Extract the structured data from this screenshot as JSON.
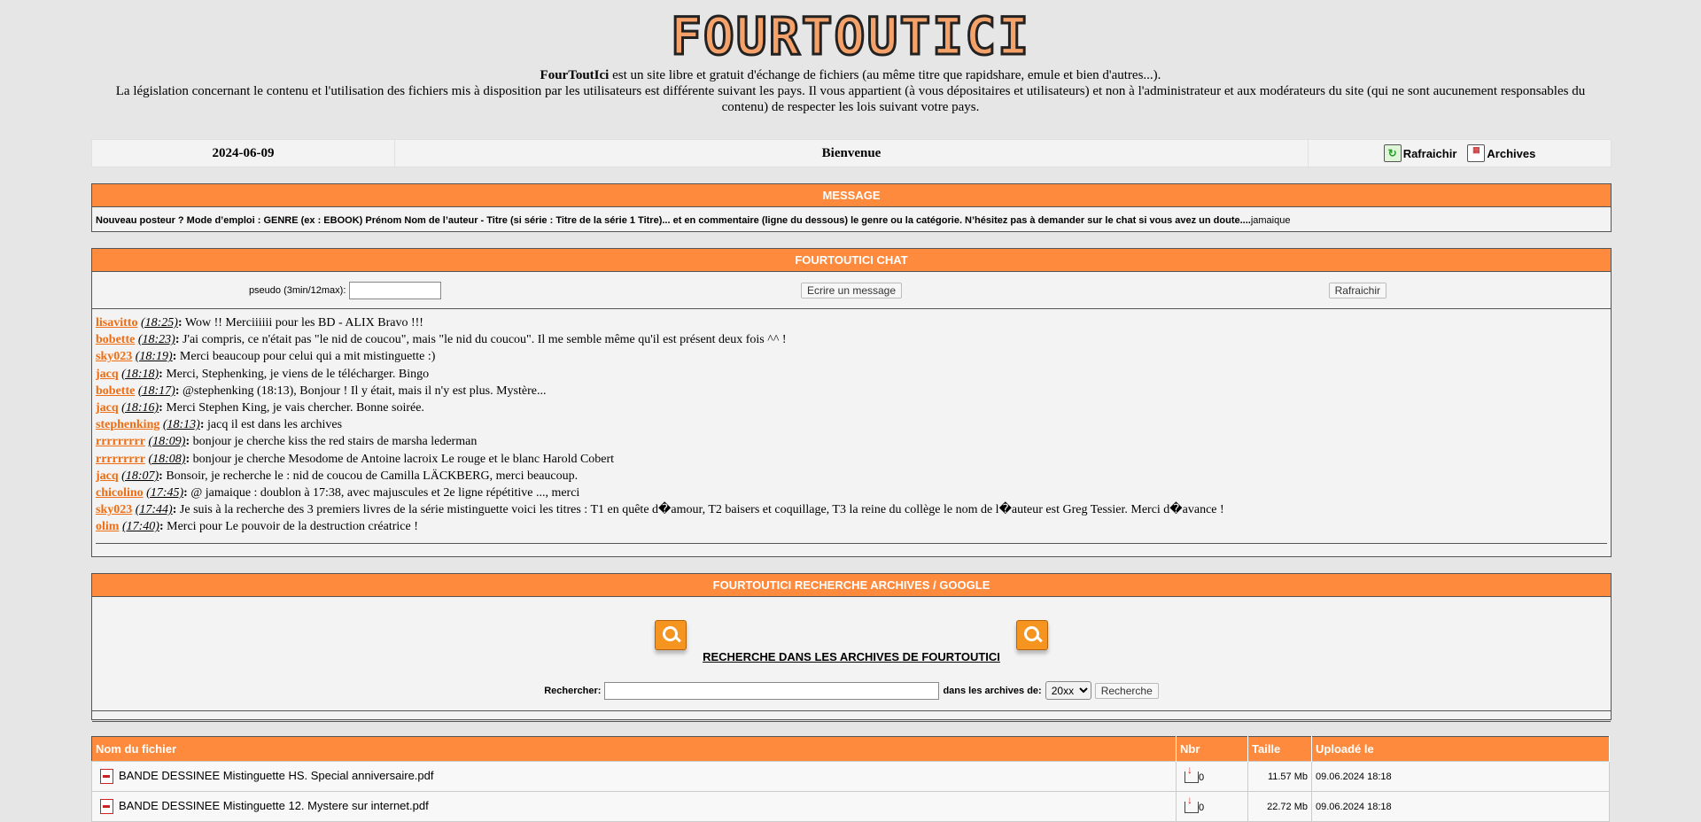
{
  "logo_text": "FOURTOUTICI",
  "intro": {
    "site_name": "FourToutIci",
    "line1_rest": " est un site libre et gratuit d'échange de fichiers (au même titre que rapidshare, emule et bien d'autres...).",
    "line2": "La législation concernant le contenu et l'utilisation des fichiers mis à disposition par les utilisateurs est différente suivant les pays. Il vous appartient (à vous dépositaires et utilisateurs) et non à l'administrateur et aux modérateurs du site (qui ne sont aucunement responsables du contenu) de respecter les lois suivant votre pays."
  },
  "topbar": {
    "date": "2024-06-09",
    "welcome": "Bienvenue",
    "refresh_label": "Rafraichir",
    "archives_label": "Archives"
  },
  "message": {
    "header": "MESSAGE",
    "text": "Nouveau posteur ? Mode d’emploi : GENRE (ex : EBOOK) Prénom Nom de l’auteur - Titre (si série : Titre de la série 1 Titre)... et en commentaire (ligne du dessous) le genre ou la catégorie. N’hésitez pas à demander sur le chat si vous avez un doute....",
    "author": "jamaique"
  },
  "chat": {
    "header": "FOURTOUTICI CHAT",
    "pseudo_label": "pseudo (3min/12max):",
    "pseudo_value": "",
    "write_button": "Ecrire un message",
    "refresh_button": "Rafraichir",
    "messages": [
      {
        "nick": "lisavitto",
        "time": "(18:25)",
        "text": " Wow !! Merciiiiii pour les BD - ALIX Bravo !!!"
      },
      {
        "nick": "bobette",
        "time": "(18:23)",
        "text": " J'ai compris, ce n'était pas \"le nid de coucou\", mais \"le nid du coucou\". Il me semble même qu'il est présent deux fois ^^ !"
      },
      {
        "nick": "sky023",
        "time": "(18:19)",
        "text": " Merci beaucoup pour celui qui a mit mistinguette :)"
      },
      {
        "nick": "jacq",
        "time": "(18:18)",
        "text": " Merci, Stephenking, je viens de le télécharger. Bingo"
      },
      {
        "nick": "bobette",
        "time": "(18:17)",
        "text": " @stephenking (18:13), Bonjour ! Il y était, mais il n'y est plus. Mystère..."
      },
      {
        "nick": "jacq",
        "time": "(18:16)",
        "text": " Merci Stephen King, je vais chercher. Bonne soirée."
      },
      {
        "nick": "stephenking",
        "time": "(18:13)",
        "text": " jacq il est dans les archives"
      },
      {
        "nick": "rrrrrrrrr",
        "time": "(18:09)",
        "text": " bonjour je cherche kiss the red stairs de marsha lederman"
      },
      {
        "nick": "rrrrrrrrr",
        "time": "(18:08)",
        "text": " bonjour je cherche Mesodome de Antoine lacroix Le rouge et le blanc Harold Cobert"
      },
      {
        "nick": "jacq",
        "time": "(18:07)",
        "text": " Bonsoir, je recherche le : nid de coucou de Camilla LÄCKBERG, merci beaucoup."
      },
      {
        "nick": "chicolino",
        "time": "(17:45)",
        "text": " @ jamaique : doublon à 17:38, avec majuscules et 2e ligne répétitive ..., merci"
      },
      {
        "nick": "sky023",
        "time": "(17:44)",
        "text": " Je suis à la recherche des 3 premiers livres de la série mistinguette voici les titres : T1 en quête d�amour, T2 baisers et coquillage, T3 la reine du collège le nom de l�auteur est Greg Tessier. Merci d�avance !"
      },
      {
        "nick": "olim",
        "time": "(17:40)",
        "text": " Merci pour Le pouvoir de la destruction créatrice !"
      }
    ]
  },
  "search": {
    "header": "FOURTOUTICI RECHERCHE ARCHIVES / GOOGLE",
    "title": "RECHERCHE DANS LES ARCHIVES DE FOURTOUTICI",
    "label": "Rechercher:",
    "input_value": "",
    "archives_label": "dans les archives de:",
    "select_value": "20xx",
    "button": "Recherche"
  },
  "files": {
    "columns": [
      "Nom du fichier",
      "Nbr",
      "Taille",
      "Uploadé le"
    ],
    "rows": [
      {
        "name": "BANDE DESSINEE Mistinguette HS. Special anniversaire.pdf",
        "nbr": "0",
        "size": "11.57 Mb",
        "date": "09.06.2024 18:18"
      },
      {
        "name": "BANDE DESSINEE Mistinguette 12. Mystere sur internet.pdf",
        "nbr": "0",
        "size": "22.72 Mb",
        "date": "09.06.2024 18:18"
      }
    ]
  },
  "colors": {
    "accent_orange": "#fd8a3d",
    "nick_orange": "#ef6d12",
    "background": "#e6e6e6"
  }
}
